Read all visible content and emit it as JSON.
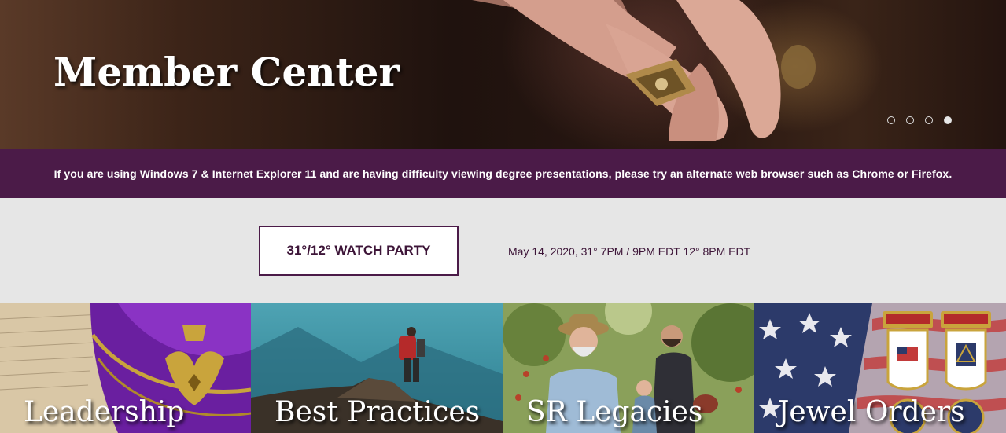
{
  "hero": {
    "title": "Member Center",
    "slides": [
      {
        "label": "slide 1",
        "active": false
      },
      {
        "label": "slide 2",
        "active": false
      },
      {
        "label": "slide 3",
        "active": false
      },
      {
        "label": "slide 4",
        "active": true
      }
    ]
  },
  "notice": {
    "text": "If you are using Windows 7 & Internet Explorer 11 and are having difficulty viewing degree presentations, please try an alternate web browser such as Chrome or Firefox."
  },
  "event": {
    "button_label": "31°/12° WATCH PARTY",
    "date_text": "May 14, 2020, 31° 7PM / 9PM EDT 12° 8PM EDT"
  },
  "tiles": [
    {
      "label": "Leadership",
      "icon": "purple-cap-image"
    },
    {
      "label": "Best Practices",
      "icon": "hiker-image"
    },
    {
      "label": "SR Legacies",
      "icon": "family-image"
    },
    {
      "label": "Jewel Orders",
      "icon": "flag-jewels-image"
    }
  ],
  "colors": {
    "brand_purple": "#4b1b48",
    "band_gray": "#e6e6e6"
  }
}
